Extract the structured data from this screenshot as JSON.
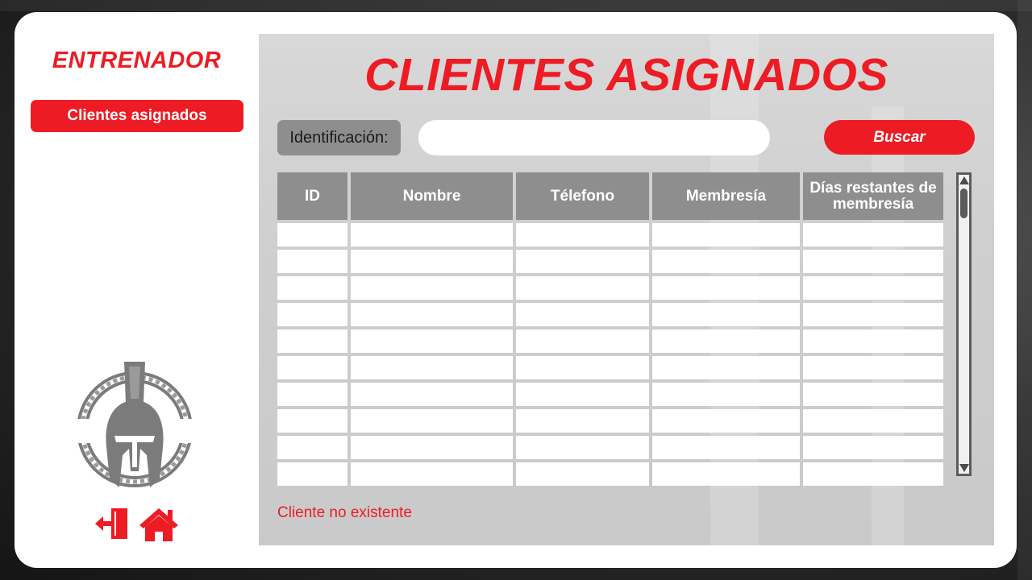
{
  "sidebar": {
    "brand": "ENTRENADOR",
    "nav_button": "Clientes asignados",
    "logo_icon": "spartan-helmet-logo",
    "logout_icon": "logout-door-icon",
    "home_icon": "home-icon"
  },
  "main": {
    "title": "CLIENTES ASIGNADOS",
    "search": {
      "label": "Identificación:",
      "value": "",
      "placeholder": "",
      "button": "Buscar"
    },
    "table": {
      "columns": [
        "ID",
        "Nombre",
        "Télefono",
        "Membresía",
        "Días restantes de membresía"
      ],
      "rows": [
        [
          "",
          "",
          "",
          "",
          ""
        ],
        [
          "",
          "",
          "",
          "",
          ""
        ],
        [
          "",
          "",
          "",
          "",
          ""
        ],
        [
          "",
          "",
          "",
          "",
          ""
        ],
        [
          "",
          "",
          "",
          "",
          ""
        ],
        [
          "",
          "",
          "",
          "",
          ""
        ],
        [
          "",
          "",
          "",
          "",
          ""
        ],
        [
          "",
          "",
          "",
          "",
          ""
        ],
        [
          "",
          "",
          "",
          "",
          ""
        ],
        [
          "",
          "",
          "",
          "",
          ""
        ]
      ]
    },
    "status_message": "Cliente no existente"
  },
  "colors": {
    "accent": "#ed1c24",
    "header_gray": "#8e8e8e",
    "panel_gray": "#d0d0d0"
  }
}
